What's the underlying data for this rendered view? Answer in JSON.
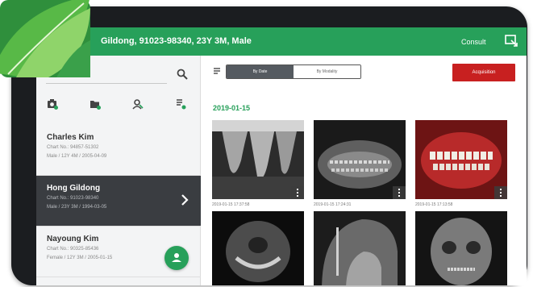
{
  "header": {
    "title": "Gildong, 91023-98340, 23Y 3M, Male",
    "consult_label": "Consult",
    "background": "#27a05a"
  },
  "sidebar": {
    "search_icon": "search-icon",
    "tools": [
      "camera-icon",
      "folder-icon",
      "person-search-icon",
      "document-icon"
    ],
    "patients": [
      {
        "name": "Charles Kim",
        "chart": "Chart No.: 94857-51302",
        "info": "Male / 12Y 4M / 2005-04-09",
        "selected": false
      },
      {
        "name": "Hong Gildong",
        "chart": "Chart No.: 91023-98340",
        "info": "Male / 23Y 3M / 1994-03-05",
        "selected": true
      },
      {
        "name": "Nayoung Kim",
        "chart": "Chart No.: 90325-85436",
        "info": "Female / 12Y 3M / 2005-01-15",
        "selected": false
      }
    ],
    "fab_icon": "add-person-icon"
  },
  "main": {
    "view_toggle": {
      "option_1": "By Date",
      "option_2": "By Modality",
      "selected": "By Date"
    },
    "acquisition_label": "Acquisition",
    "acquisition_color": "#c82020",
    "date_group": "2019-01-15",
    "images": [
      {
        "kind": "periapical x-ray",
        "timestamp": "2019-01-15 17:37:58"
      },
      {
        "kind": "panoramic x-ray",
        "timestamp": "2019-01-15 17:24:31"
      },
      {
        "kind": "intraoral photo",
        "timestamp": "2019-01-15 17:13:58"
      },
      {
        "kind": "ct axial slice",
        "timestamp": ""
      },
      {
        "kind": "cephalometric x-ray",
        "timestamp": ""
      },
      {
        "kind": "skull pa x-ray",
        "timestamp": ""
      }
    ]
  },
  "logo": {
    "type": "green leaf brand logo"
  }
}
